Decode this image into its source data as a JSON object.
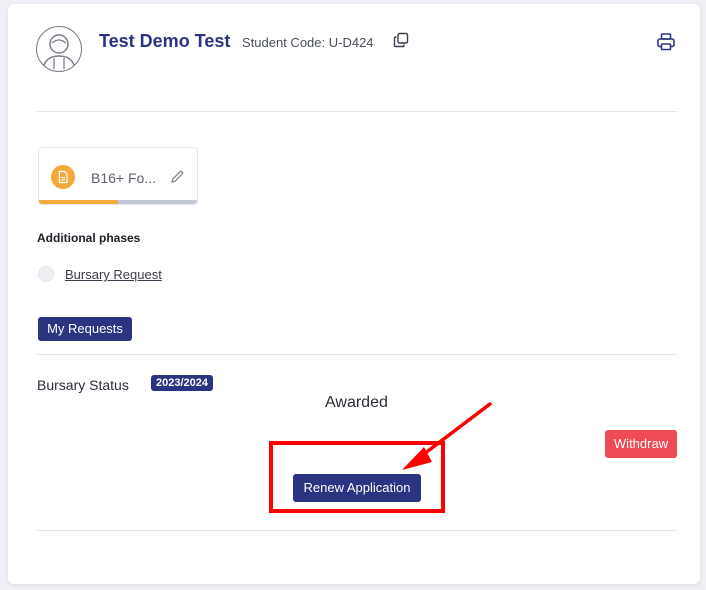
{
  "student": {
    "name": "Test Demo Test",
    "code_label": "Student Code: U-D424"
  },
  "icons": {
    "avatar": "user-avatar-icon",
    "copy": "copy-icon",
    "print": "printer-icon",
    "document": "document-icon",
    "edit": "pencil-icon"
  },
  "phase": {
    "label": "B16+ Fo...",
    "progress_fraction": 0.5
  },
  "additional": {
    "title": "Additional phases",
    "items": [
      {
        "label": "Bursary Request"
      }
    ]
  },
  "buttons": {
    "my_requests": "My Requests",
    "withdraw": "Withdraw",
    "renew": "Renew Application"
  },
  "status": {
    "title": "Bursary Status",
    "year": "2023/2024",
    "value": "Awarded"
  },
  "colors": {
    "primary": "#2a3480",
    "accent_orange": "#f6a93b",
    "danger": "#ef4b55",
    "annotation_red": "#ff0000"
  }
}
